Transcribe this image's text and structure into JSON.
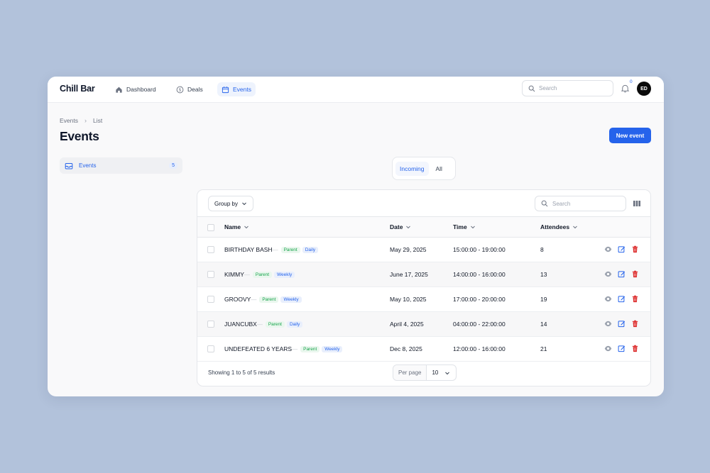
{
  "app": {
    "name": "Chill Bar"
  },
  "nav": [
    {
      "label": "Dashboard",
      "icon": "home-icon"
    },
    {
      "label": "Deals",
      "icon": "dollar-icon"
    },
    {
      "label": "Events",
      "icon": "calendar-icon",
      "active": true
    }
  ],
  "topbar": {
    "search_placeholder": "Search",
    "notification_count": "0",
    "avatar_initials": "ED"
  },
  "breadcrumb": [
    "Events",
    "List"
  ],
  "page": {
    "title": "Events",
    "new_button": "New event"
  },
  "sidebar": {
    "items": [
      {
        "label": "Events",
        "count": "5",
        "icon": "inbox-icon"
      }
    ]
  },
  "tabs": [
    {
      "label": "Incoming",
      "active": true
    },
    {
      "label": "All"
    }
  ],
  "table": {
    "group_by": "Group by",
    "search_placeholder": "Search",
    "columns": [
      "Name",
      "Date",
      "Time",
      "Attendees"
    ],
    "rows": [
      {
        "name": "BIRTHDAY BASH",
        "parent": "Parent",
        "freq": "Daily",
        "date": "May 29, 2025",
        "time": "15:00:00 - 19:00:00",
        "attendees": "8"
      },
      {
        "name": "KIMMY",
        "parent": "Parent",
        "freq": "Weekly",
        "date": "June 17, 2025",
        "time": "14:00:00 - 16:00:00",
        "attendees": "13"
      },
      {
        "name": "GROOVY",
        "parent": "Parent",
        "freq": "Weekly",
        "date": "May 10, 2025",
        "time": "17:00:00 - 20:00:00",
        "attendees": "19"
      },
      {
        "name": "JUANCUBX",
        "parent": "Parent",
        "freq": "Daily",
        "date": "April 4, 2025",
        "time": "04:00:00 - 22:00:00",
        "attendees": "14"
      },
      {
        "name": "UNDEFEATED 6 YEARS",
        "parent": "Parent",
        "freq": "Weekly",
        "date": "Dec 8, 2025",
        "time": "12:00:00 - 16:00:00",
        "attendees": "21"
      }
    ],
    "footer": {
      "summary": "Showing 1 to 5 of 5 results",
      "per_page_label": "Per page",
      "per_page_value": "10"
    }
  },
  "colors": {
    "accent": "#2563eb",
    "background": "#b2c2db",
    "delete": "#dc2626",
    "parent_badge": "#16a34a"
  }
}
